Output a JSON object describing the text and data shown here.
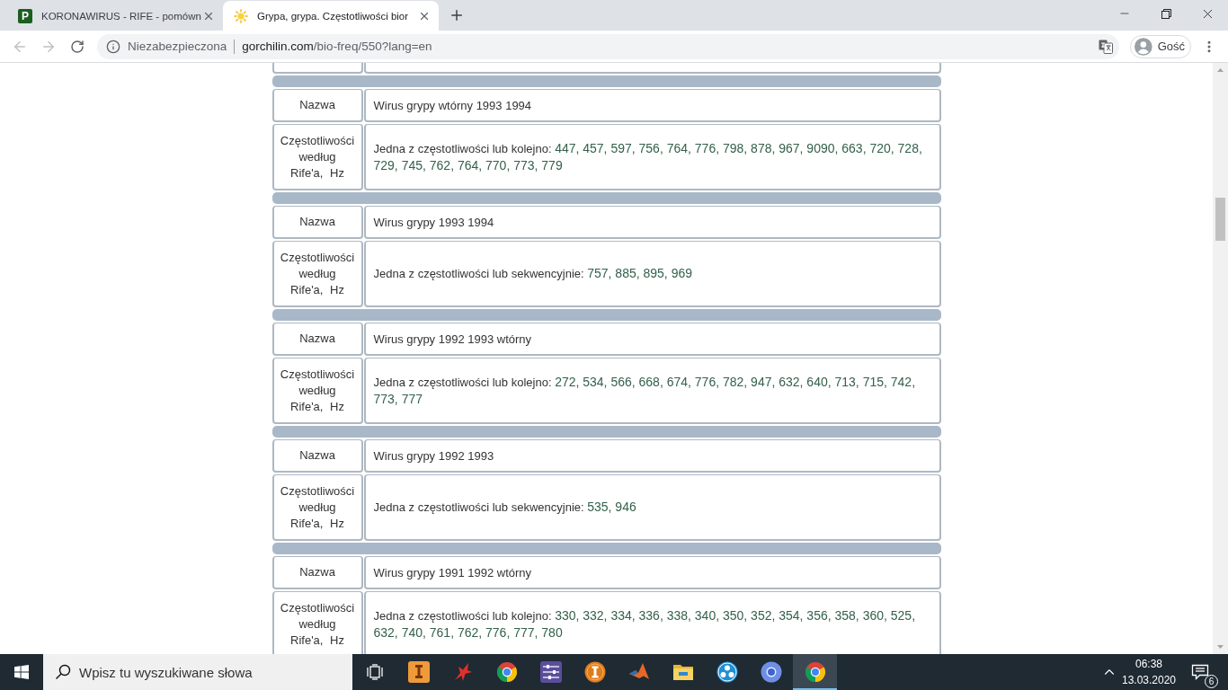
{
  "browser": {
    "tabs": [
      {
        "kind": "letter",
        "favicon_letter": "P",
        "title": "KORONAWIRUS - RIFE - pomówn",
        "selected": false
      },
      {
        "kind": "sun",
        "title": "Grypa, grypa. Częstotliwości bior",
        "selected": true
      }
    ],
    "navigation": {
      "back_disabled": true,
      "forward_disabled": true
    },
    "address_bar": {
      "security_label": "Niezabezpieczona",
      "url_host": "gorchilin.com",
      "url_path": "/bio-freq/550?lang=en"
    },
    "profile": {
      "label": "Gość"
    }
  },
  "page": {
    "entries": [
      {
        "name_label": "Nazwa",
        "name": "Wirus grypy wtórny 1993 1994",
        "freq_label": "Częstotliwości według Rife'a, Hz",
        "freq_intro": "Jedna z częstotliwości lub kolejno:",
        "frequencies": "447, 457, 597, 756, 764, 776, 798, 878, 967, 9090, 663, 720, 728, 729, 745, 762, 764, 770, 773, 779"
      },
      {
        "name_label": "Nazwa",
        "name": "Wirus grypy 1993 1994",
        "freq_label": "Częstotliwości według Rife'a, Hz",
        "freq_intro": "Jedna z częstotliwości lub sekwencyjnie:",
        "frequencies": "757, 885, 895, 969"
      },
      {
        "name_label": "Nazwa",
        "name": "Wirus grypy 1992 1993 wtórny",
        "freq_label": "Częstotliwości według Rife'a, Hz",
        "freq_intro": "Jedna z częstotliwości lub kolejno:",
        "frequencies": "272, 534, 566, 668, 674, 776, 782, 947, 632, 640, 713, 715, 742, 773, 777"
      },
      {
        "name_label": "Nazwa",
        "name": "Wirus grypy 1992 1993",
        "freq_label": "Częstotliwości według Rife'a, Hz",
        "freq_intro": "Jedna z częstotliwości lub sekwencyjnie:",
        "frequencies": "535, 946"
      },
      {
        "name_label": "Nazwa",
        "name": "Wirus grypy 1991 1992 wtórny",
        "freq_label": "Częstotliwości według Rife'a, Hz",
        "freq_intro": "Jedna z częstotliwości lub kolejno:",
        "frequencies": "330, 332, 334, 336, 338, 340, 350, 352, 354, 356, 358, 360, 525, 632, 740, 761, 762, 776, 777, 780"
      }
    ]
  },
  "taskbar": {
    "search": {
      "placeholder": "Wpisz tu wyszukiwane słowa"
    },
    "apps": [
      {
        "kind": "tile",
        "selected": false
      },
      {
        "kind": "star",
        "selected": false
      },
      {
        "kind": "segmented",
        "selected": false
      },
      {
        "kind": "sliders",
        "selected": false
      },
      {
        "kind": "emblem",
        "selected": false
      },
      {
        "kind": "peak",
        "selected": false
      },
      {
        "kind": "folder",
        "selected": false
      },
      {
        "kind": "dots",
        "selected": false
      },
      {
        "kind": "ring",
        "selected": false
      },
      {
        "kind": "segmented",
        "selected": true
      }
    ],
    "clock": {
      "time": "06:38",
      "date": "13.03.2020"
    },
    "notifications": {
      "count": "6"
    }
  }
}
